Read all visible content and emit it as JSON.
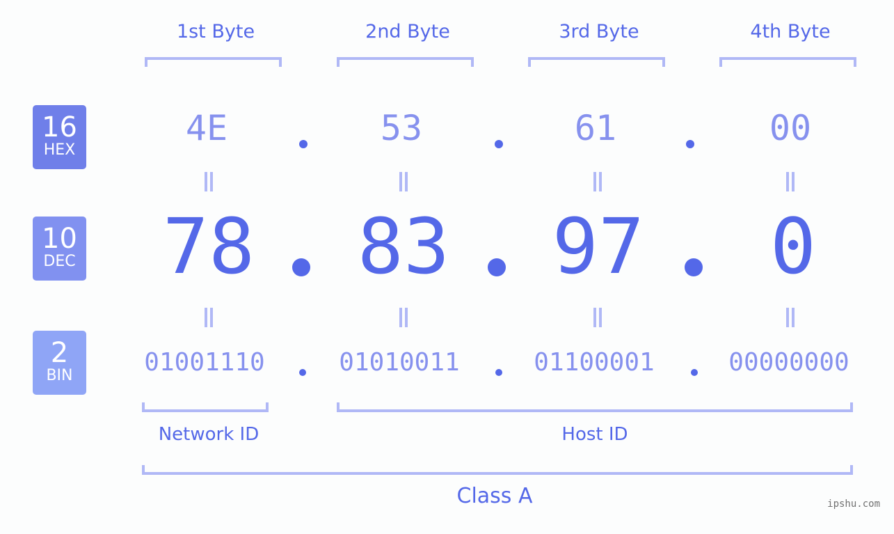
{
  "bytes": [
    {
      "label": "1st Byte",
      "hex": "4E",
      "dec": "78",
      "bin": "01001110"
    },
    {
      "label": "2nd Byte",
      "hex": "53",
      "dec": "83",
      "bin": "01010011"
    },
    {
      "label": "3rd Byte",
      "hex": "61",
      "dec": "97",
      "bin": "01100001"
    },
    {
      "label": "4th Byte",
      "hex": "00",
      "dec": "0",
      "bin": "00000000"
    }
  ],
  "badges": {
    "hex": {
      "num": "16",
      "label": "HEX",
      "color": "#6f7fe9"
    },
    "dec": {
      "num": "10",
      "label": "DEC",
      "color": "#8191f0"
    },
    "bin": {
      "num": "2",
      "label": "BIN",
      "color": "#8fa5f6"
    }
  },
  "segments": {
    "network": "Network ID",
    "host": "Host ID",
    "class": "Class A"
  },
  "watermark": "ipshu.com",
  "colors": {
    "accent": "#5468e8",
    "light": "#8691ee",
    "bracket": "#b0b8f6"
  }
}
